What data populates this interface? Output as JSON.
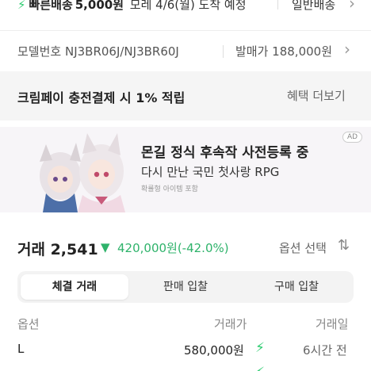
{
  "shipping": {
    "fast_label": "빠른배송",
    "fast_price": "5,000원",
    "fast_eta": "모레 4/6(월) 도착 예정",
    "normal_label": "일반배송"
  },
  "product": {
    "model_text": "모델번호 NJ3BR06J/NJ3BR60J",
    "release_text": "발매가 188,000원"
  },
  "promo": {
    "text": "크림페이 충전결제 시 1% 적립",
    "more_label": "혜택 더보기"
  },
  "ad": {
    "title": "몬길 정식 후속작 사전등록 중",
    "subtitle": "다시 만난 국민 첫사랑 RPG",
    "note": "확률형 아이템 포함",
    "badge": "AD"
  },
  "trade": {
    "label": "거래 2,541",
    "arrow": "▼",
    "change": "420,000원(-42.0%)",
    "option_select": "옵션 선택",
    "tabs": [
      {
        "label": "체결 거래",
        "active": true
      },
      {
        "label": "판매 입찰",
        "active": false
      },
      {
        "label": "구매 입찰",
        "active": false
      }
    ],
    "columns": [
      "옵션",
      "거래가",
      "거래일"
    ],
    "rows": [
      {
        "option": "L",
        "price": "580,000원",
        "date": "6시간 전"
      }
    ]
  },
  "colors": {
    "accent_green": "#2fb36b",
    "bolt_green": "#2ecc71"
  }
}
